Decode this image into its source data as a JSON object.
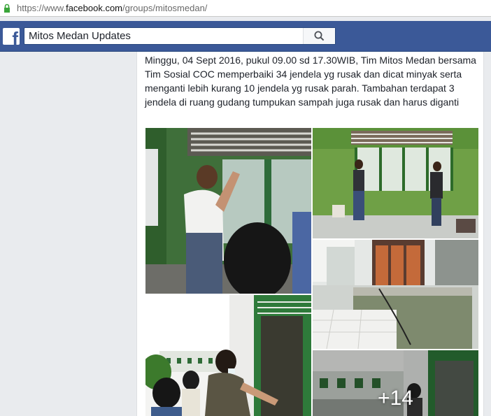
{
  "browser": {
    "url_prefix": "https://www.",
    "url_host": "facebook.com",
    "url_path": "/groups/mitosmedan/"
  },
  "header": {
    "logo_letter": "f",
    "search_value": "Mitos Medan Updates",
    "brand_color": "#3b5998"
  },
  "post": {
    "text": "Minggu, 04 Sept 2016, pukul 09.00 sd 17.30WIB, Tim Mitos Medan bersama Tim Sosial COC memperbaiki 34 jendela yg rusak dan dicat minyak serta menganti lebih kurang 10 jendela yg rusak parah. Tambahan terdapat 3 jendela di ruang gudang tumpukan sampah juga rusak dan harus diganti",
    "more_photos": "+14"
  }
}
